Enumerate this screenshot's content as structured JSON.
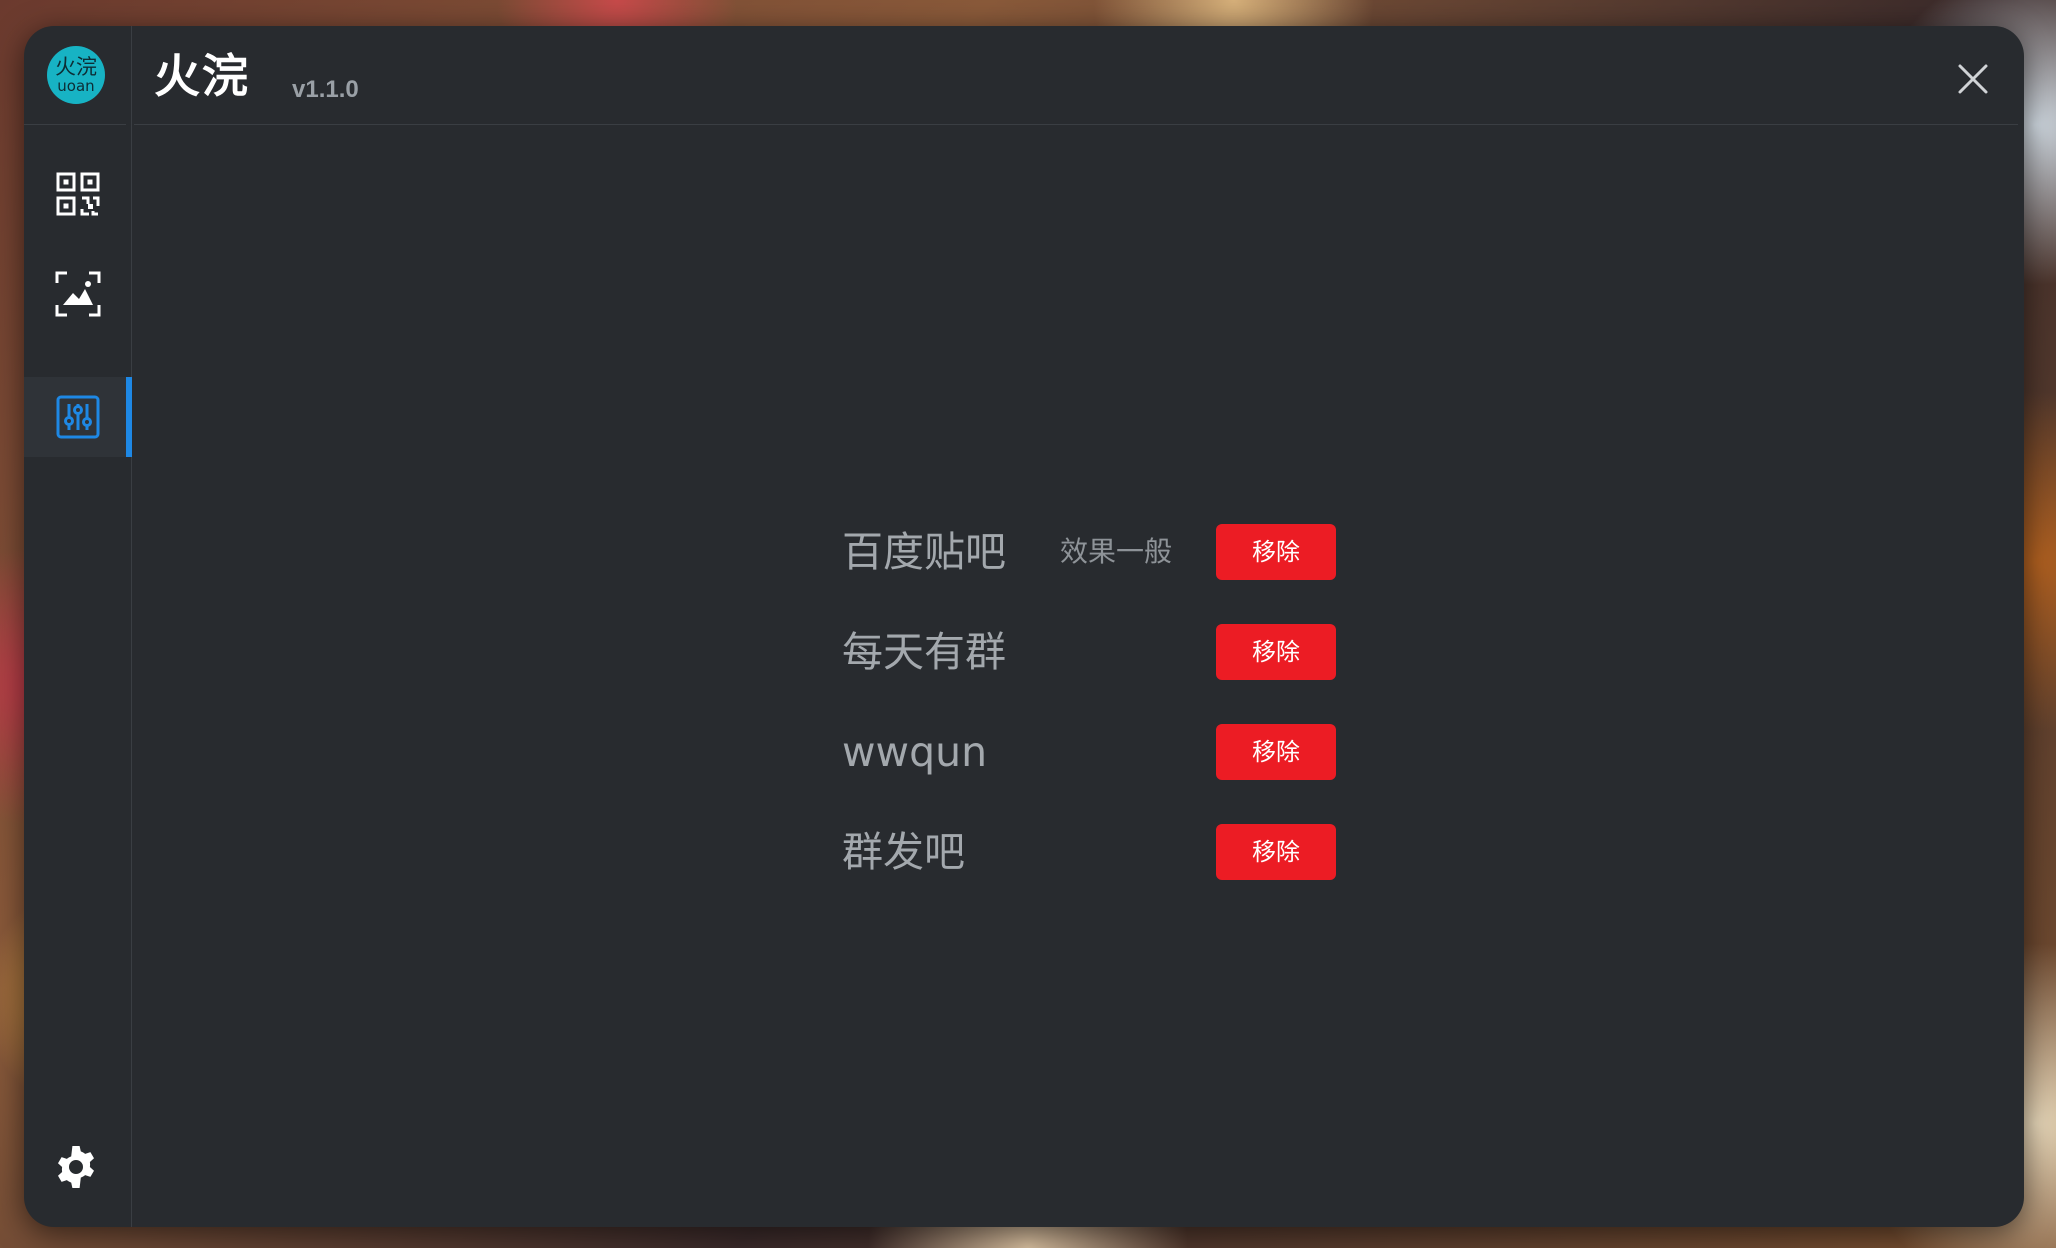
{
  "app": {
    "logo_line1": "火浣",
    "logo_line2": "uoan",
    "title": "火浣",
    "version": "v1.1.0"
  },
  "sidebar": {
    "items": [
      {
        "icon": "qr-code-icon",
        "active": false
      },
      {
        "icon": "screenshot-icon",
        "active": false
      },
      {
        "icon": "sliders-icon",
        "active": true
      }
    ],
    "settings_icon": "gear-icon"
  },
  "entries": [
    {
      "name": "百度贴吧",
      "note": "效果一般",
      "action": "移除"
    },
    {
      "name": "每天有群",
      "note": "",
      "action": "移除"
    },
    {
      "name": "wwqun",
      "note": "",
      "action": "移除"
    },
    {
      "name": "群发吧",
      "note": "",
      "action": "移除"
    }
  ],
  "colors": {
    "window_bg": "#282b2f",
    "accent": "#1e88e5",
    "danger": "#ec1c24",
    "logo": "#17b3c4"
  }
}
